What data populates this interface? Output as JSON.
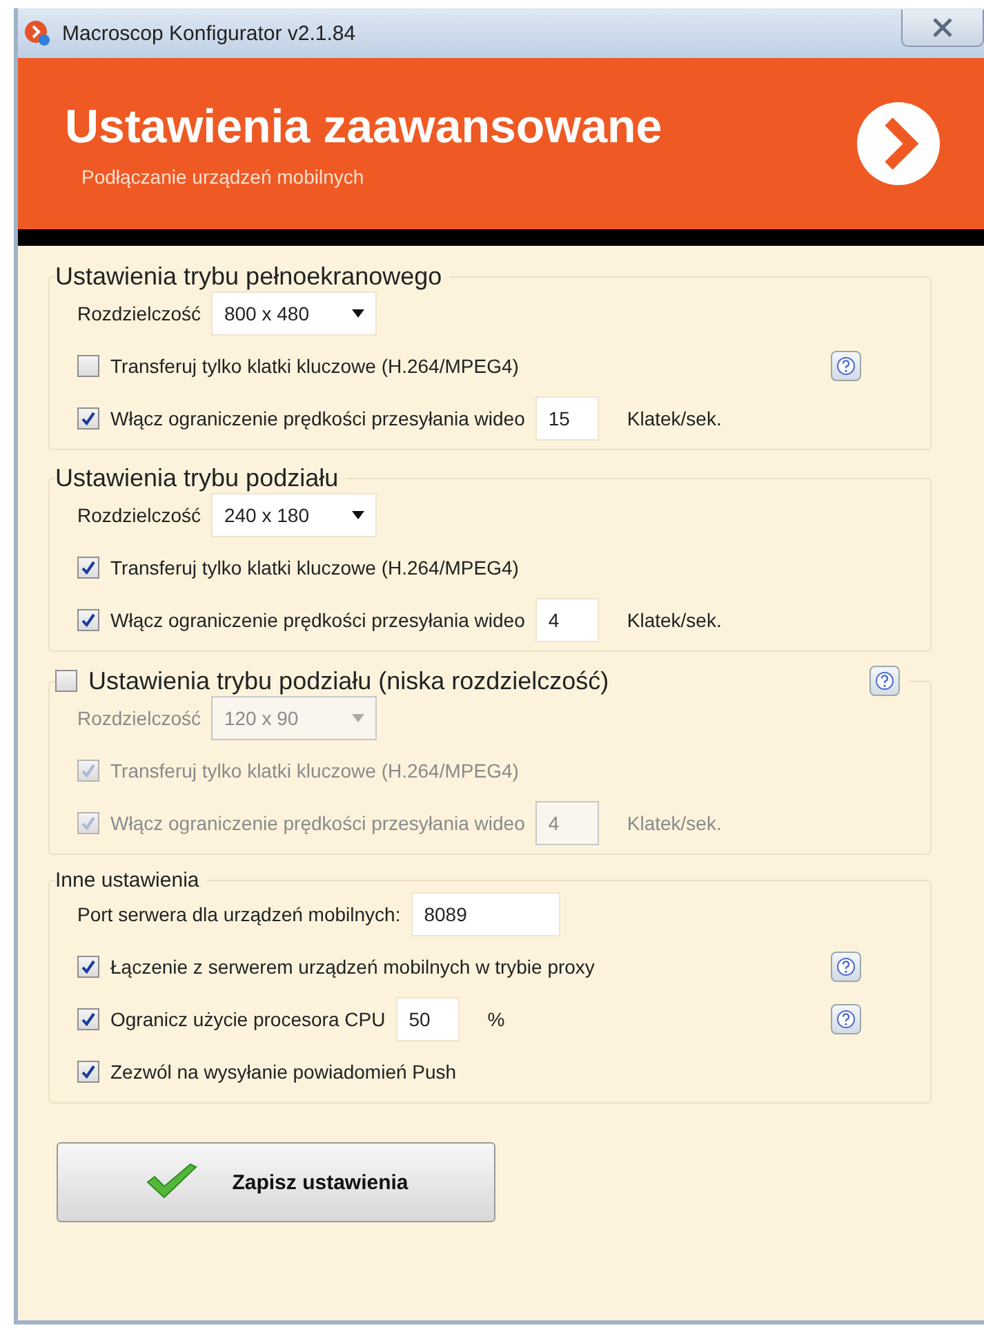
{
  "window": {
    "title": "Macroscop Konfigurator v2.1.84"
  },
  "header": {
    "title": "Ustawienia zaawansowane",
    "subtitle": "Podłączanie urządzeń mobilnych"
  },
  "groups": [
    {
      "title": "Ustawienia trybu pełnoekranowego",
      "checkable": false,
      "disabled": false,
      "help": false,
      "rows": [
        {
          "kind": "dropdown",
          "label": "Rozdzielczość",
          "value": "800 x 480"
        },
        {
          "kind": "checkbox",
          "label": "Transferuj tylko klatki kluczowe (H.264/MPEG4)",
          "checked": false,
          "help": true
        },
        {
          "kind": "checkbox_number",
          "label": "Włącz ograniczenie prędkości przesyłania wideo",
          "checked": true,
          "value": "15",
          "unit": "Klatek/sek.",
          "help": false
        }
      ]
    },
    {
      "title": "Ustawienia trybu podziału",
      "checkable": false,
      "disabled": false,
      "help": false,
      "rows": [
        {
          "kind": "dropdown",
          "label": "Rozdzielczość",
          "value": "240 x 180"
        },
        {
          "kind": "checkbox",
          "label": "Transferuj tylko klatki kluczowe (H.264/MPEG4)",
          "checked": true,
          "help": false
        },
        {
          "kind": "checkbox_number",
          "label": "Włącz ograniczenie prędkości przesyłania wideo",
          "checked": true,
          "value": "4",
          "unit": "Klatek/sek.",
          "help": false
        }
      ]
    },
    {
      "title": "Ustawienia trybu podziału (niska rozdzielczość)",
      "checkable": true,
      "checked": false,
      "disabled": true,
      "help": true,
      "rows": [
        {
          "kind": "dropdown",
          "label": "Rozdzielczość",
          "value": "120 x 90"
        },
        {
          "kind": "checkbox",
          "label": "Transferuj tylko klatki kluczowe (H.264/MPEG4)",
          "checked": true,
          "help": false
        },
        {
          "kind": "checkbox_number",
          "label": "Włącz ograniczenie prędkości przesyłania wideo",
          "checked": true,
          "value": "4",
          "unit": "Klatek/sek.",
          "help": false
        }
      ]
    },
    {
      "title": "Inne ustawienia",
      "checkable": false,
      "disabled": false,
      "help": false,
      "rows": [
        {
          "kind": "field",
          "label": "Port serwera dla urządzeń mobilnych:",
          "value": "8089"
        },
        {
          "kind": "checkbox",
          "label": "Łączenie z serwerem urządzeń mobilnych w trybie proxy",
          "checked": true,
          "help": true
        },
        {
          "kind": "checkbox_number",
          "label": "Ogranicz użycie procesora CPU",
          "checked": true,
          "value": "50",
          "unit": "%",
          "help": true
        },
        {
          "kind": "checkbox",
          "label": "Zezwól na wysyłanie powiadomień Push",
          "checked": true,
          "help": false
        }
      ]
    }
  ],
  "save_button": {
    "label": "Zapisz ustawienia"
  }
}
